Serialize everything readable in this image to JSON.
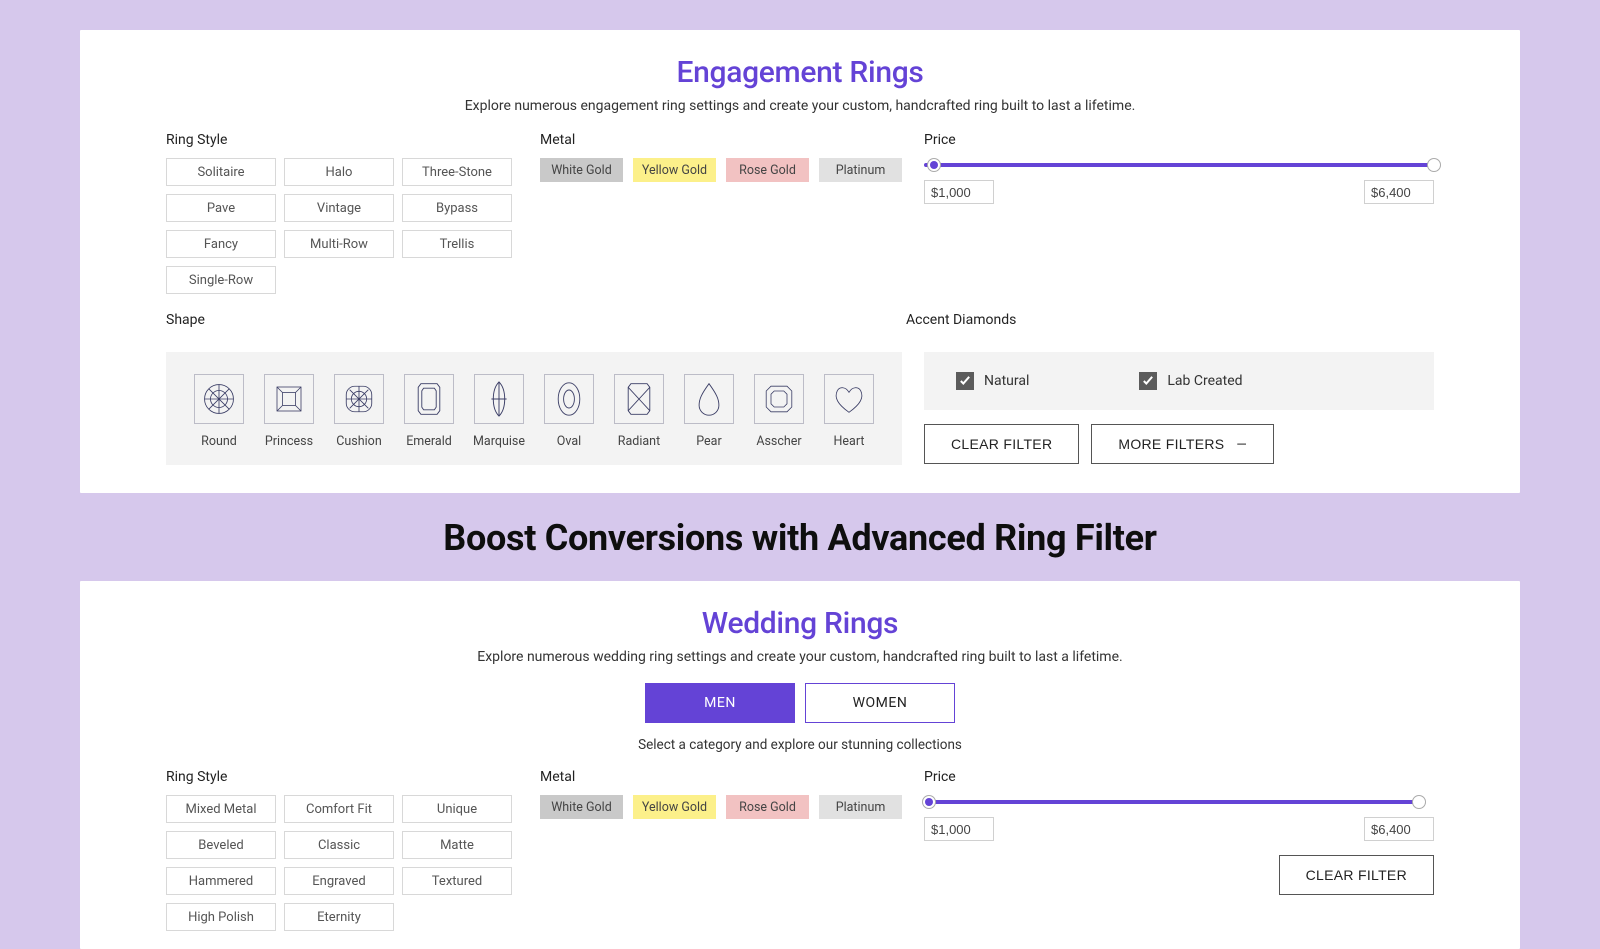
{
  "engagement": {
    "title": "Engagement Rings",
    "subtitle": "Explore numerous engagement ring settings and create your custom, handcrafted ring built to last a lifetime.",
    "ring_style_label": "Ring Style",
    "ring_styles": [
      "Solitaire",
      "Halo",
      "Three-Stone",
      "Pave",
      "Vintage",
      "Bypass",
      "Fancy",
      "Multi-Row",
      "Trellis",
      "Single-Row"
    ],
    "metal_label": "Metal",
    "metals": [
      "White Gold",
      "Yellow Gold",
      "Rose Gold",
      "Platinum"
    ],
    "price_label": "Price",
    "price_min": "$1,000",
    "price_max": "$6,400",
    "shape_label": "Shape",
    "shapes": [
      "Round",
      "Princess",
      "Cushion",
      "Emerald",
      "Marquise",
      "Oval",
      "Radiant",
      "Pear",
      "Asscher",
      "Heart"
    ],
    "accent_label": "Accent Diamonds",
    "accents": [
      "Natural",
      "Lab Created"
    ],
    "clear_filter": "CLEAR FILTER",
    "more_filters": "MORE FILTERS"
  },
  "headline": "Boost Conversions with Advanced Ring Filter",
  "wedding": {
    "title": "Wedding Rings",
    "subtitle": "Explore numerous wedding ring settings and create your custom, handcrafted ring built to last a lifetime.",
    "tabs": [
      "MEN",
      "WOMEN"
    ],
    "category_hint": "Select a category and explore our stunning collections",
    "ring_style_label": "Ring Style",
    "ring_styles": [
      "Mixed Metal",
      "Comfort Fit",
      "Unique",
      "Beveled",
      "Classic",
      "Matte",
      "Hammered",
      "Engraved",
      "Textured",
      "High Polish",
      "Eternity"
    ],
    "metal_label": "Metal",
    "metals": [
      "White Gold",
      "Yellow Gold",
      "Rose Gold",
      "Platinum"
    ],
    "price_label": "Price",
    "price_min": "$1,000",
    "price_max": "$6,400",
    "clear_filter": "CLEAR FILTER"
  }
}
